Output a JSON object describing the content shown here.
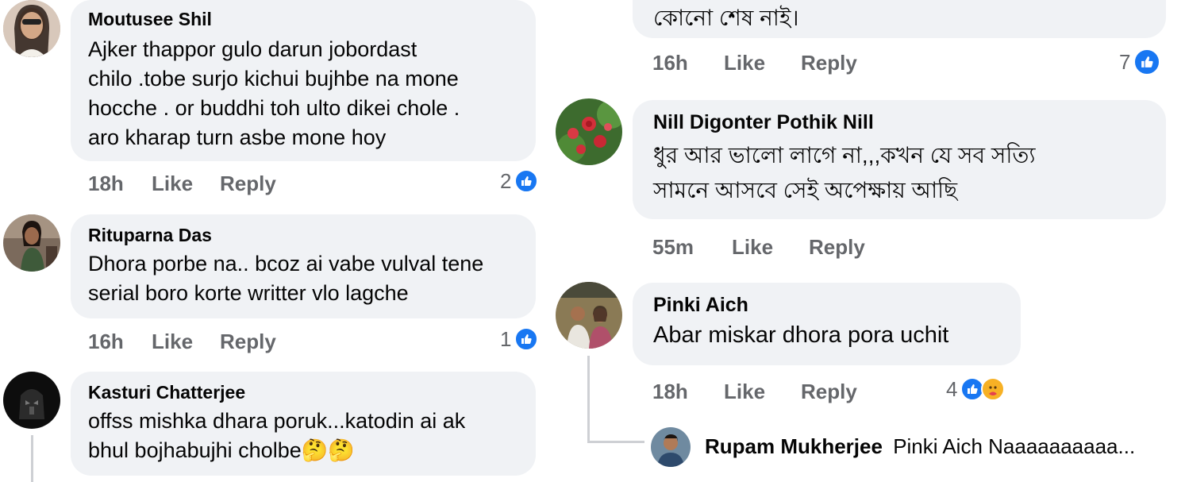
{
  "left_comments": [
    {
      "name": "Moutusee Shil",
      "text": "Ajker thappor gulo darun jobordast\nchilo .tobe surjo kichui bujhbe na mone\nhocche . or buddhi toh ulto dikei chole .\naro kharap turn asbe mone hoy",
      "time": "18h",
      "like": "Like",
      "reply": "Reply",
      "reaction_count": "2"
    },
    {
      "name": "Rituparna Das",
      "text": "Dhora porbe na.. bcoz ai vabe vulval tene\nserial boro korte writter vlo lagche",
      "time": "16h",
      "like": "Like",
      "reply": "Reply",
      "reaction_count": "1"
    },
    {
      "name": "Kasturi Chatterjee",
      "text": "offss mishka dhara poruk...katodin ai ak\nbhul bojhabujhi cholbe🤔🤔"
    }
  ],
  "right_comments": [
    {
      "text": "কোনো শেষ নাই।",
      "time": "16h",
      "like": "Like",
      "reply": "Reply",
      "reaction_count": "7"
    },
    {
      "name": "Nill Digonter Pothik Nill",
      "text": "ধুর আর ভালো লাগে না,,,কখন যে সব সত্যি\nসামনে আসবে সেই অপেক্ষায় আছি",
      "time": "55m",
      "like": "Like",
      "reply": "Reply"
    },
    {
      "name": "Pinki Aich",
      "text": "Abar miskar dhora pora uchit",
      "time": "18h",
      "like": "Like",
      "reply": "Reply",
      "reaction_count": "4"
    }
  ],
  "reply_preview": {
    "name": "Rupam Mukherjee",
    "text": "Pinki Aich Naaaaaaaaaa..."
  },
  "colors": {
    "bubble": "#f0f2f5",
    "meta_text": "#65676b",
    "like_blue": "#1877f2",
    "care_yellow": "#f7b125"
  }
}
